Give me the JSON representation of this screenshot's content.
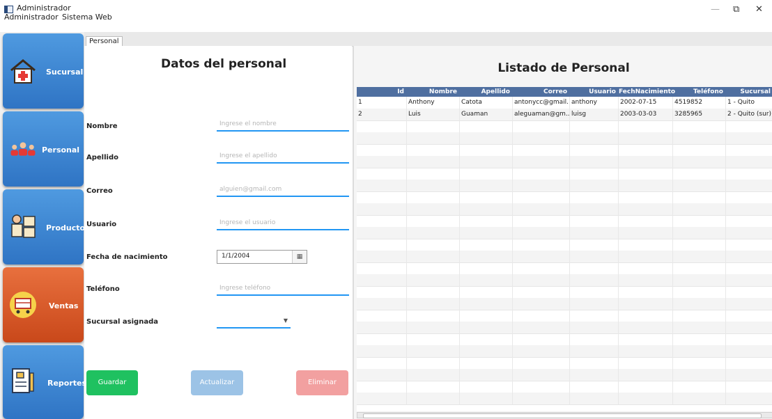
{
  "window": {
    "title": "Administrador",
    "minimize_icon": "—",
    "restore_icon": "⧉",
    "close_icon": "✕"
  },
  "menu": {
    "items": [
      "Administrador",
      "Sistema Web"
    ]
  },
  "sidebar": {
    "items": [
      {
        "label": "Sucursal",
        "icon": "hospital-icon"
      },
      {
        "label": "Personal",
        "icon": "people-icon"
      },
      {
        "label": "Productos",
        "icon": "worker-boxes-icon"
      },
      {
        "label": "Ventas",
        "icon": "cart-icon"
      },
      {
        "label": "Reportes",
        "icon": "checklist-icon"
      }
    ]
  },
  "tabs": [
    {
      "label": "Personal"
    }
  ],
  "form": {
    "title": "Datos del  personal",
    "fields": [
      {
        "label": "Nombre",
        "placeholder": "Ingrese el nombre"
      },
      {
        "label": "Apellido",
        "placeholder": "Ingrese el apellido"
      },
      {
        "label": "Correo",
        "placeholder": "alguien@gmail.com"
      },
      {
        "label": "Usuario",
        "placeholder": "Ingrese el usuario"
      },
      {
        "label": "Fecha de nacimiento",
        "value": "1/1/2004",
        "calendar_icon": "▦"
      },
      {
        "label": "Teléfono",
        "placeholder": "Ingrese teléfono"
      },
      {
        "label": "Sucursal asignada",
        "value": "",
        "arrow_icon": "▼"
      }
    ],
    "buttons": [
      {
        "label": "Guardar",
        "color": "#1fc160"
      },
      {
        "label": "Actualizar",
        "color": "#9cc3e6"
      },
      {
        "label": "Eliminar",
        "color": "#f2a0a0"
      }
    ]
  },
  "list": {
    "title": "Listado de Personal",
    "columns": [
      "Id",
      "Nombre",
      "Apellido",
      "Correo",
      "Usuario",
      "FechNacimiento",
      "Teléfono",
      "Sucursal"
    ],
    "rows": [
      [
        "1",
        "Anthony",
        "Catota",
        "antonycc@gmail...",
        "anthony",
        "2002-07-15",
        "4519852",
        "1 - Quito"
      ],
      [
        "2",
        "Luis",
        "Guaman",
        "aleguaman@gm...",
        "luisg",
        "2003-03-03",
        "3285965",
        "2 - Quito (sur)"
      ]
    ],
    "empty_rows": 24
  },
  "colors": {
    "header_bg": "#4f6fa0",
    "accent": "#2196f3",
    "sidebar_blue": "#3a86d6",
    "sidebar_orange": "#d9572a"
  }
}
